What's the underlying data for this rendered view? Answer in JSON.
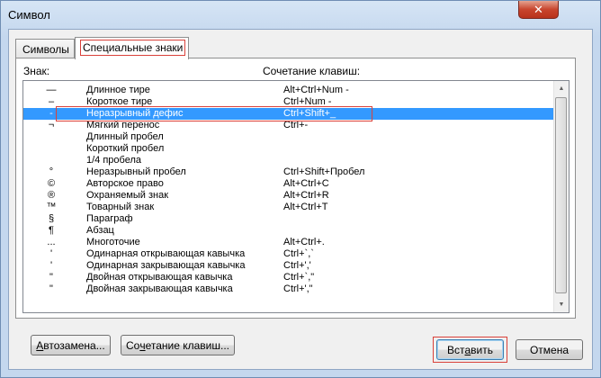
{
  "window": {
    "title": "Символ",
    "close_label": "✕"
  },
  "tabs": [
    {
      "label": "Символы",
      "active": false
    },
    {
      "label": "Специальные знаки",
      "active": true
    }
  ],
  "list": {
    "header_sign": "Знак:",
    "header_keys": "Сочетание клавиш:",
    "selected_index": 2,
    "rows": [
      {
        "sym": "—",
        "name": "Длинное тире",
        "keys": "Alt+Ctrl+Num -"
      },
      {
        "sym": "–",
        "name": "Короткое тире",
        "keys": "Ctrl+Num -"
      },
      {
        "sym": "-",
        "name": "Неразрывный дефис",
        "keys": "Ctrl+Shift+_"
      },
      {
        "sym": "¬",
        "name": "Мягкий перенос",
        "keys": "Ctrl+-"
      },
      {
        "sym": "",
        "name": "Длинный пробел",
        "keys": ""
      },
      {
        "sym": "",
        "name": "Короткий пробел",
        "keys": ""
      },
      {
        "sym": "",
        "name": "1/4 пробела",
        "keys": ""
      },
      {
        "sym": "°",
        "name": "Неразрывный пробел",
        "keys": "Ctrl+Shift+Пробел"
      },
      {
        "sym": "©",
        "name": "Авторское право",
        "keys": "Alt+Ctrl+C"
      },
      {
        "sym": "®",
        "name": "Охраняемый знак",
        "keys": "Alt+Ctrl+R"
      },
      {
        "sym": "™",
        "name": "Товарный знак",
        "keys": "Alt+Ctrl+T"
      },
      {
        "sym": "§",
        "name": "Параграф",
        "keys": ""
      },
      {
        "sym": "¶",
        "name": "Абзац",
        "keys": ""
      },
      {
        "sym": "...",
        "name": "Многоточие",
        "keys": "Alt+Ctrl+."
      },
      {
        "sym": "'",
        "name": "Одинарная открывающая кавычка",
        "keys": "Ctrl+`,`"
      },
      {
        "sym": "'",
        "name": "Одинарная закрывающая кавычка",
        "keys": "Ctrl+','"
      },
      {
        "sym": "\"",
        "name": "Двойная открывающая кавычка",
        "keys": "Ctrl+`,\""
      },
      {
        "sym": "\"",
        "name": "Двойная закрывающая кавычка",
        "keys": "Ctrl+',\""
      }
    ]
  },
  "buttons": {
    "autocorrect_u": "А",
    "autocorrect_rest": "втозамена...",
    "shortcut_pre": "Со",
    "shortcut_u": "ч",
    "shortcut_rest": "етание клавиш...",
    "insert_pre": "Вст",
    "insert_u": "а",
    "insert_rest": "вить",
    "cancel": "Отмена"
  },
  "colors": {
    "selection": "#3399ff",
    "highlight_outline": "#d9413a"
  }
}
